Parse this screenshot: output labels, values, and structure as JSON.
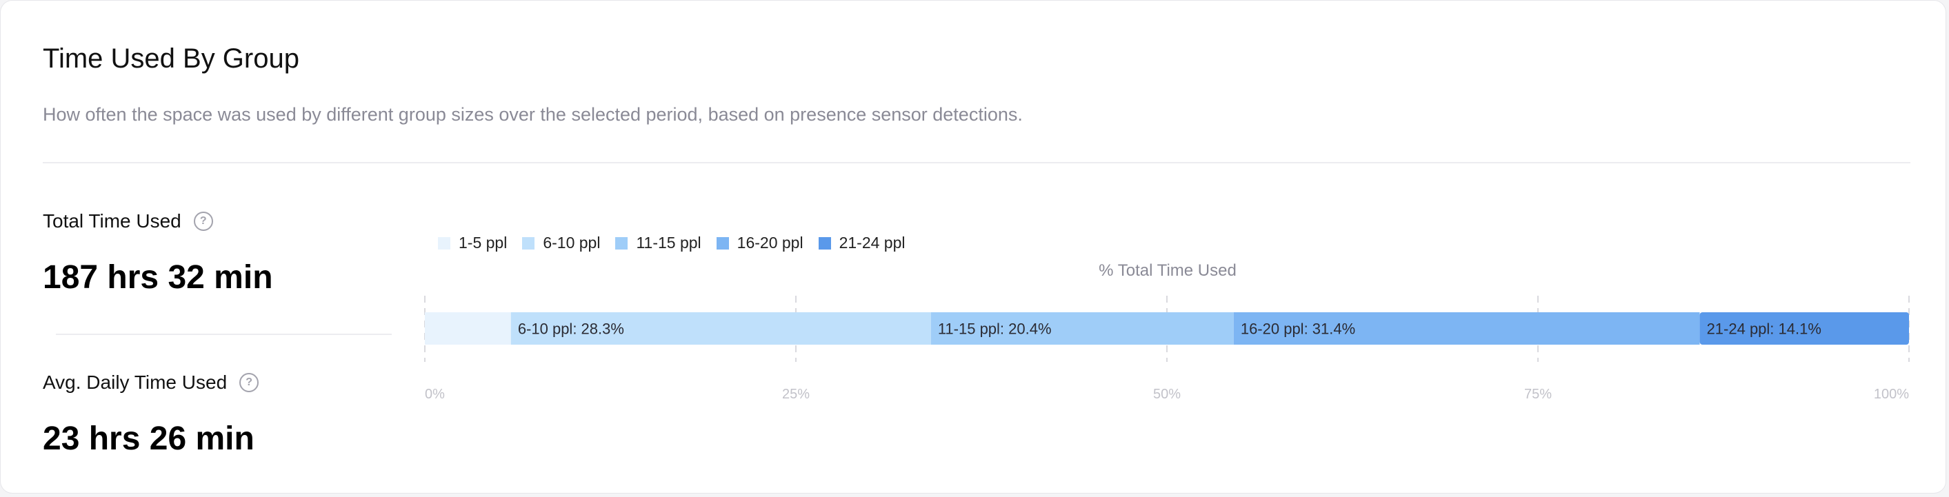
{
  "card": {
    "title": "Time Used By Group",
    "subtitle": "How often the space was used by different group sizes over the selected period, based on presence sensor detections."
  },
  "stats": {
    "total_label": "Total Time Used",
    "total_value": "187 hrs 32 min",
    "avg_label": "Avg. Daily Time Used",
    "avg_value": "23 hrs 26 min",
    "help_icon": "question-circle-icon"
  },
  "chart_data": {
    "type": "bar",
    "orientation": "horizontal-stacked",
    "title": "% Total Time Used",
    "categories": [
      "1-5 ppl",
      "6-10 ppl",
      "11-15 ppl",
      "16-20 ppl",
      "21-24 ppl"
    ],
    "values": [
      5.8,
      28.3,
      20.4,
      31.4,
      14.1
    ],
    "data_labels": [
      "",
      "6-10 ppl: 28.3%",
      "11-15 ppl: 20.4%",
      "16-20 ppl: 31.4%",
      "21-24 ppl: 14.1%"
    ],
    "colors": [
      "#e8f3fd",
      "#bfe0fb",
      "#9fcdf8",
      "#7db5f3",
      "#5a99ea"
    ],
    "xlim": [
      0,
      100
    ],
    "ticks": [
      "0%",
      "25%",
      "50%",
      "75%",
      "100%"
    ],
    "tick_values": [
      0,
      25,
      50,
      75,
      100
    ],
    "grid": true,
    "legend_position": "top-left"
  }
}
